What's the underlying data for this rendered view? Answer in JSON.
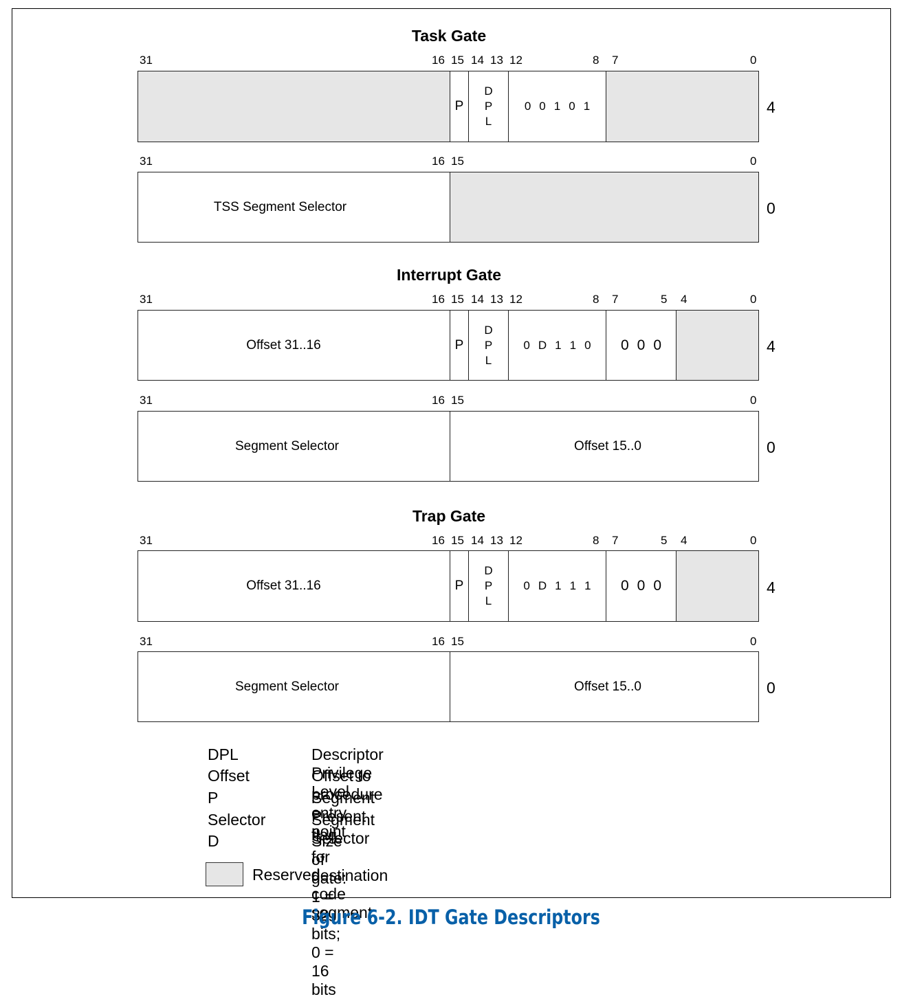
{
  "caption": "Figure 6-2.  IDT Gate Descriptors",
  "colors": {
    "reserved_fill": "#e6e6e6",
    "caption": "#0860a8"
  },
  "gates": {
    "task": {
      "title": "Task Gate",
      "high": {
        "offset": "4",
        "bits": [
          "31",
          "16",
          "15",
          "14",
          "13",
          "12",
          "8",
          "7",
          "0"
        ],
        "p": "P",
        "dpl": [
          "D",
          "P",
          "L"
        ],
        "type": [
          "0",
          "0",
          "1",
          "0",
          "1"
        ]
      },
      "low": {
        "offset": "0",
        "bits": [
          "31",
          "16",
          "15",
          "0"
        ],
        "left": "TSS Segment Selector"
      }
    },
    "interrupt": {
      "title": "Interrupt Gate",
      "high": {
        "offset": "4",
        "bits": [
          "31",
          "16",
          "15",
          "14",
          "13",
          "12",
          "8",
          "7",
          "5",
          "4",
          "0"
        ],
        "left": "Offset 31..16",
        "p": "P",
        "dpl": [
          "D",
          "P",
          "L"
        ],
        "type": [
          "0",
          "D",
          "1",
          "1",
          "0"
        ],
        "zeros": [
          "0",
          "0",
          "0"
        ]
      },
      "low": {
        "offset": "0",
        "bits": [
          "31",
          "16",
          "15",
          "0"
        ],
        "left": "Segment Selector",
        "right": "Offset 15..0"
      }
    },
    "trap": {
      "title": "Trap Gate",
      "high": {
        "offset": "4",
        "bits": [
          "31",
          "16",
          "15",
          "14",
          "13",
          "12",
          "8",
          "7",
          "5",
          "4",
          "0"
        ],
        "left": "Offset 31..16",
        "p": "P",
        "dpl": [
          "D",
          "P",
          "L"
        ],
        "type": [
          "0",
          "D",
          "1",
          "1",
          "1"
        ],
        "zeros": [
          "0",
          "0",
          "0"
        ]
      },
      "low": {
        "offset": "0",
        "bits": [
          "31",
          "16",
          "15",
          "0"
        ],
        "left": "Segment Selector",
        "right": "Offset 15..0"
      }
    }
  },
  "legend": {
    "items": [
      {
        "key": "DPL",
        "desc": "Descriptor Privilege Level"
      },
      {
        "key": "Offset",
        "desc": "Offset to procedure entry point"
      },
      {
        "key": "P",
        "desc": "Segment Present flag"
      },
      {
        "key": "Selector",
        "desc": "Segment Selector for destination code segment"
      },
      {
        "key": "D",
        "desc": "Size of gate: 1 = 32 bits; 0 = 16 bits"
      }
    ],
    "reserved_label": "Reserved"
  }
}
